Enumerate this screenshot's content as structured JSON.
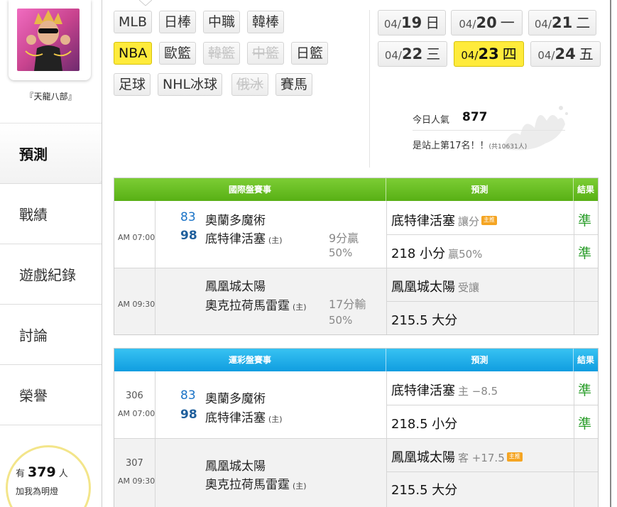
{
  "sidebar": {
    "username": "『天龍八部』",
    "menu": [
      {
        "label": "預測",
        "active": true
      },
      {
        "label": "戰績",
        "active": false
      },
      {
        "label": "遊戲紀錄",
        "active": false
      },
      {
        "label": "討論",
        "active": false
      },
      {
        "label": "榮譽",
        "active": false
      }
    ],
    "fans": {
      "prefix": "有",
      "count": "379",
      "suffix": "人",
      "line2": "加我為明燈"
    }
  },
  "leagues": {
    "row1": [
      "MLB",
      "日棒",
      "中職",
      "韓棒"
    ],
    "row2": [
      "NBA",
      "歐籃",
      "韓籃",
      "中籃",
      "日籃"
    ],
    "row3": [
      "足球",
      "NHL冰球",
      "俄冰",
      "賽馬"
    ],
    "active": "NBA",
    "disabled": [
      "韓籃",
      "中籃",
      "俄冰"
    ]
  },
  "dates": [
    {
      "md": "04/",
      "dd": "19",
      "wd": "日",
      "active": false
    },
    {
      "md": "04/",
      "dd": "20",
      "wd": "一",
      "active": false
    },
    {
      "md": "04/",
      "dd": "21",
      "wd": "二",
      "active": false
    },
    {
      "md": "04/",
      "dd": "22",
      "wd": "三",
      "active": false
    },
    {
      "md": "04/",
      "dd": "23",
      "wd": "四",
      "active": true
    },
    {
      "md": "04/",
      "dd": "24",
      "wd": "五",
      "active": false
    }
  ],
  "stats": {
    "popularity_label": "今日人氣",
    "popularity_value": "877",
    "rank_text": "是站上第17名！！",
    "rank_total": "(共10631人)"
  },
  "intl_table": {
    "header": {
      "games": "國際盤賽事",
      "prediction": "預測",
      "result": "結果"
    },
    "games": [
      {
        "time": "AM 07:00",
        "away_score": "83",
        "away_team": "奧蘭多魔術",
        "home_score": "98",
        "home_team": "底特律活塞",
        "home_tag": "(主)",
        "margin": "9分贏",
        "pct": "50%",
        "picks": [
          {
            "main": "底特律活塞",
            "note": "讓分",
            "badge": "主推",
            "result": "準"
          },
          {
            "main": "218 小分",
            "note": "贏50%",
            "badge": "",
            "result": "準"
          }
        ]
      },
      {
        "time": "AM 09:30",
        "away_score": "",
        "away_team": "鳳凰城太陽",
        "home_score": "",
        "home_team": "奧克拉荷馬雷霆",
        "home_tag": "(主)",
        "margin": "17分輸",
        "pct": "50%",
        "picks": [
          {
            "main": "鳳凰城太陽",
            "note": "受讓",
            "badge": "",
            "result": ""
          },
          {
            "main": "215.5 大分",
            "note": "",
            "badge": "",
            "result": ""
          }
        ]
      }
    ]
  },
  "lottery_table": {
    "header": {
      "games": "運彩盤賽事",
      "prediction": "預測",
      "result": "結果"
    },
    "games": [
      {
        "game_no": "306",
        "time": "AM 07:00",
        "away_score": "83",
        "away_team": "奧蘭多魔術",
        "home_score": "98",
        "home_team": "底特律活塞",
        "home_tag": "(主)",
        "picks": [
          {
            "main": "底特律活塞",
            "note": "主 −8.5",
            "badge": "",
            "result": "準"
          },
          {
            "main": "218.5 小分",
            "note": "",
            "badge": "",
            "result": "準"
          }
        ]
      },
      {
        "game_no": "307",
        "time": "AM 09:30",
        "away_score": "",
        "away_team": "鳳凰城太陽",
        "home_score": "",
        "home_team": "奧克拉荷馬雷霆",
        "home_tag": "(主)",
        "picks": [
          {
            "main": "鳳凰城太陽",
            "note": "客 +17.5",
            "badge": "主推",
            "result": ""
          },
          {
            "main": "215.5 大分",
            "note": "",
            "badge": "",
            "result": ""
          }
        ]
      }
    ]
  },
  "colors": {
    "accent_yellow": "#ffeb3b",
    "intl_header": "#6cc224",
    "lottery_header": "#1aaee9",
    "result_green": "#2a9d2a",
    "score_blue": "#1a73c7"
  },
  "icons": {
    "deco": "splash-decoration-icon"
  }
}
